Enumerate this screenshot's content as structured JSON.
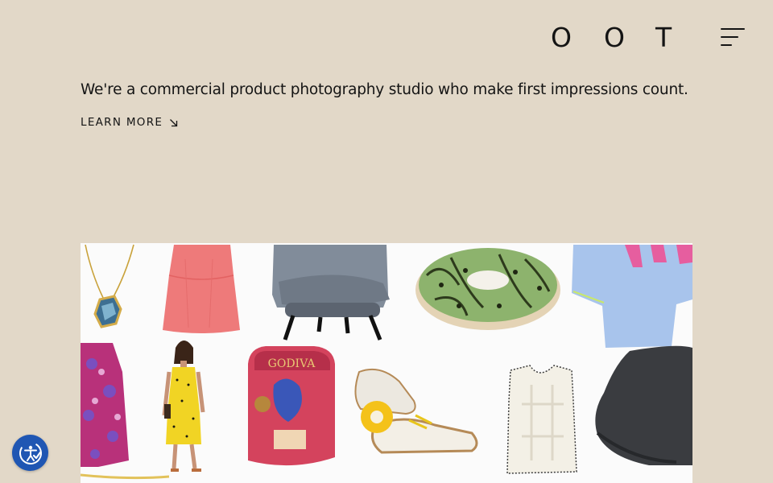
{
  "header": {
    "logo_letters": [
      "O",
      "O",
      "T"
    ],
    "menu_icon": "hamburger-menu-icon"
  },
  "hero": {
    "tagline": "We're a commercial product photography studio who make first impressions count.",
    "learn_more_label": "LEARN MORE",
    "learn_more_icon": "arrow-down-right-icon"
  },
  "collage": {
    "products": [
      "necklace",
      "pink dress",
      "grey armchair",
      "green donut",
      "blue t-shirt",
      "patterned coat",
      "model in yellow dress",
      "Godiva chocolate box",
      "sneakers",
      "knit vest",
      "black cap"
    ],
    "box_text": "GODIVA"
  },
  "accessibility": {
    "icon": "accessibility-icon"
  },
  "colors": {
    "background": "#e2d8c8",
    "text": "#141414",
    "accessibility_button": "#1f56b3"
  }
}
